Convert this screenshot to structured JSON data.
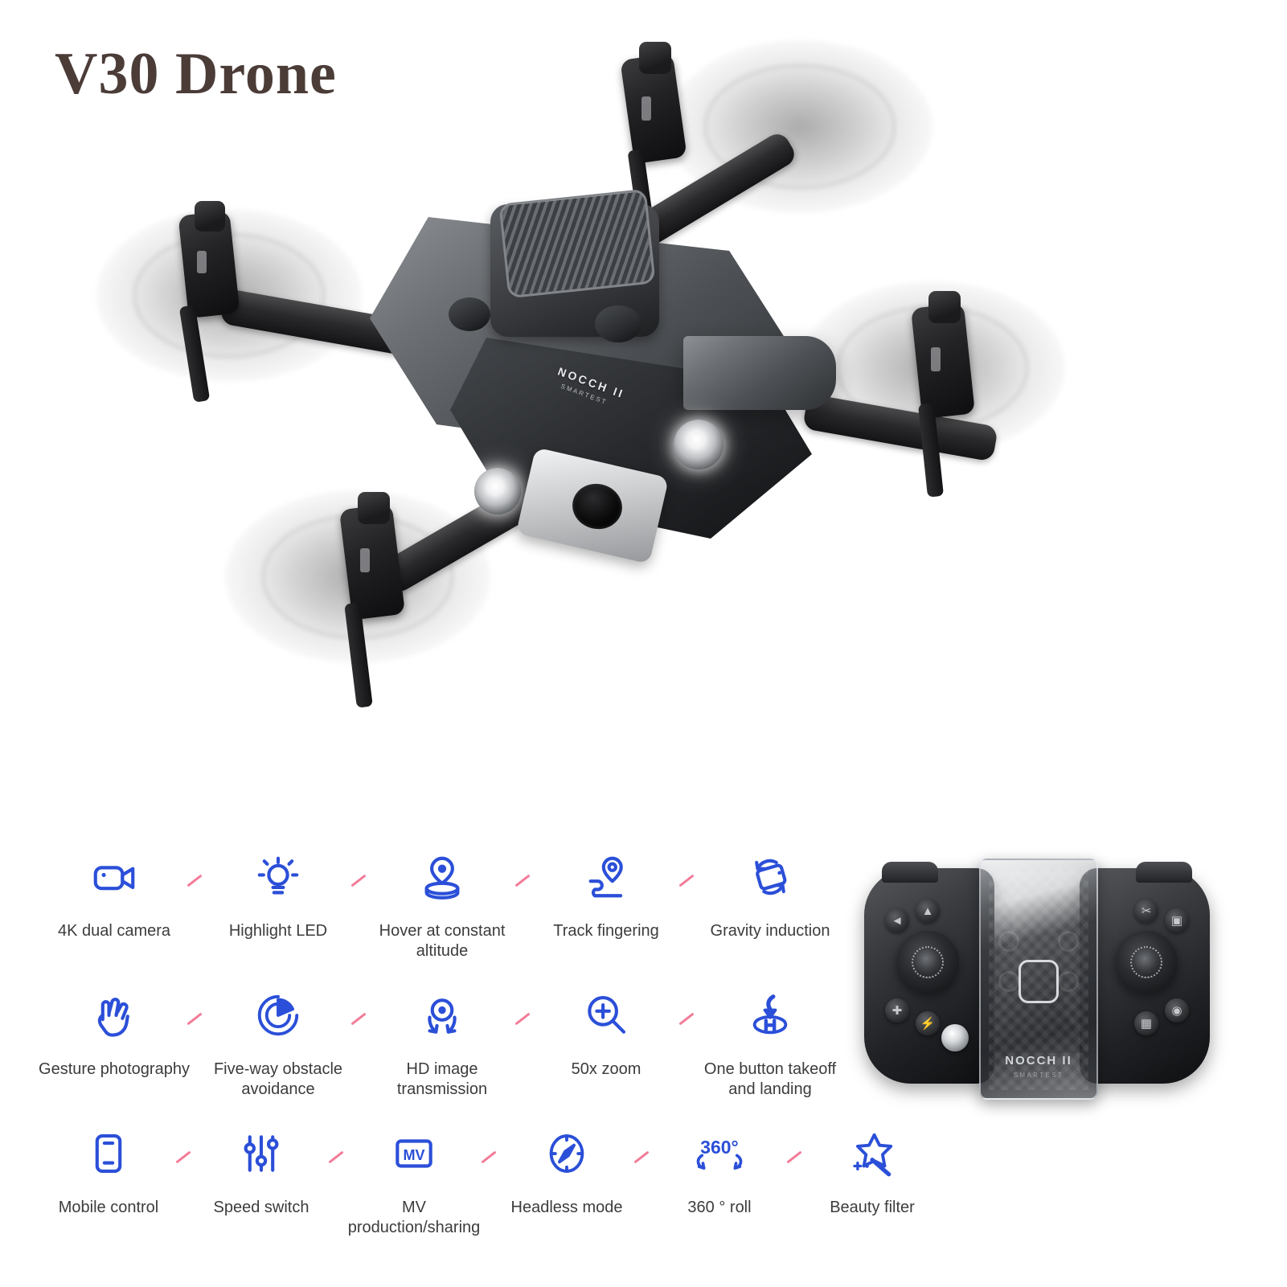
{
  "title": "V30 Drone",
  "colors": {
    "title": "#4b3c38",
    "icon_blue": "#2b4fd8",
    "label_gray": "#3c3c3c",
    "tick_pink": "#f06a8a",
    "background": "#ffffff"
  },
  "product": {
    "brand_name": "NOCCH II",
    "brand_tagline": "SMARTEST"
  },
  "features": [
    [
      {
        "icon": "video-camera-icon",
        "label": "4K dual camera"
      },
      {
        "icon": "lightbulb-icon",
        "label": "Highlight LED"
      },
      {
        "icon": "hover-altitude-icon",
        "label": "Hover at constant\naltitude"
      },
      {
        "icon": "track-path-pin-icon",
        "label": "Track fingering"
      },
      {
        "icon": "gravity-tilt-icon",
        "label": "Gravity induction"
      }
    ],
    [
      {
        "icon": "hand-gesture-icon",
        "label": "Gesture photography"
      },
      {
        "icon": "radar-obstacle-icon",
        "label": "Five-way obstacle\navoidance"
      },
      {
        "icon": "image-transmission-icon",
        "label": "HD image transmission"
      },
      {
        "icon": "magnifier-plus-icon",
        "label": "50x zoom"
      },
      {
        "icon": "takeoff-landing-icon",
        "label": "One button takeoff\nand landing"
      }
    ],
    [
      {
        "icon": "mobile-phone-icon",
        "label": "Mobile control"
      },
      {
        "icon": "sliders-icon",
        "label": "Speed switch"
      },
      {
        "icon": "mv-box-icon",
        "label": "MV production/sharing"
      },
      {
        "icon": "compass-icon",
        "label": "Headless mode"
      },
      {
        "icon": "rotate-360-icon",
        "label": "360 ° roll"
      },
      {
        "icon": "magic-wand-star-icon",
        "label": "Beauty filter"
      }
    ]
  ],
  "remote": {
    "brand_name": "NOCCH II",
    "brand_tagline": "SMARTEST"
  }
}
